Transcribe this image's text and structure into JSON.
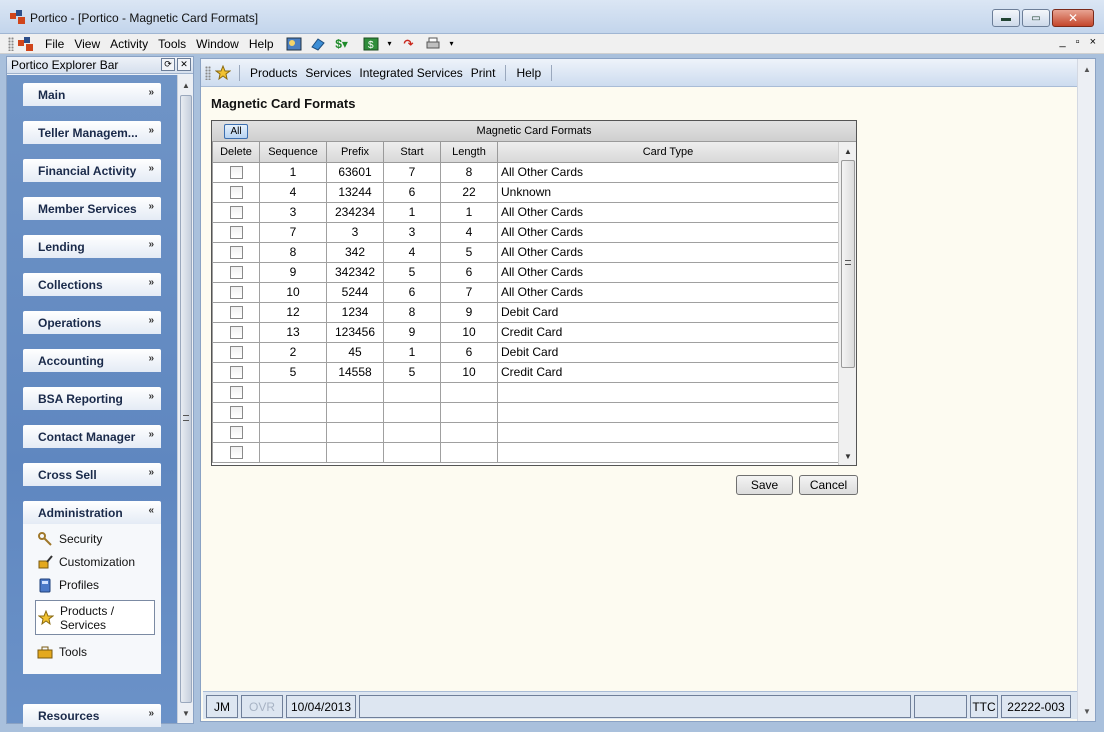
{
  "window": {
    "title": "Portico - [Portico - Magnetic Card Formats]",
    "buttons": {
      "minimize": "▬",
      "maximize": "▭",
      "close": "✕"
    }
  },
  "menubar": {
    "items": [
      "File",
      "View",
      "Activity",
      "Tools",
      "Window",
      "Help"
    ],
    "mdi": {
      "minimize": "_",
      "restore": "▫",
      "close": "×"
    }
  },
  "explorer": {
    "title": "Portico Explorer Bar",
    "groups": [
      "Main",
      "Teller Managem...",
      "Financial Activity",
      "Member Services",
      "Lending",
      "Collections",
      "Operations",
      "Accounting",
      "BSA Reporting",
      "Contact Manager",
      "Cross Sell",
      "Administration",
      "Resources"
    ],
    "admin_items": {
      "security": "Security",
      "customization": "Customization",
      "profiles": "Profiles",
      "products_line1": "Products /",
      "products_line2": "Services",
      "tools": "Tools"
    }
  },
  "inner_toolbar": {
    "items": [
      "Products",
      "Services",
      "Integrated Services",
      "Print",
      "Help"
    ]
  },
  "page": {
    "title": "Magnetic Card Formats"
  },
  "grid": {
    "caption": "Magnetic Card Formats",
    "all_button": "All",
    "columns": [
      "Delete",
      "Sequence",
      "Prefix",
      "Start",
      "Length",
      "Card Type"
    ],
    "rows": [
      {
        "sequence": "1",
        "prefix": "63601",
        "start": "7",
        "length": "8",
        "card_type": "All Other Cards"
      },
      {
        "sequence": "4",
        "prefix": "13244",
        "start": "6",
        "length": "22",
        "card_type": "Unknown"
      },
      {
        "sequence": "3",
        "prefix": "234234",
        "start": "1",
        "length": "1",
        "card_type": "All Other Cards"
      },
      {
        "sequence": "7",
        "prefix": "3",
        "start": "3",
        "length": "4",
        "card_type": "All Other Cards"
      },
      {
        "sequence": "8",
        "prefix": "342",
        "start": "4",
        "length": "5",
        "card_type": "All Other Cards"
      },
      {
        "sequence": "9",
        "prefix": "342342",
        "start": "5",
        "length": "6",
        "card_type": "All Other Cards"
      },
      {
        "sequence": "10",
        "prefix": "5244",
        "start": "6",
        "length": "7",
        "card_type": "All Other Cards"
      },
      {
        "sequence": "12",
        "prefix": "1234",
        "start": "8",
        "length": "9",
        "card_type": "Debit Card"
      },
      {
        "sequence": "13",
        "prefix": "123456",
        "start": "9",
        "length": "10",
        "card_type": "Credit Card"
      },
      {
        "sequence": "2",
        "prefix": "45",
        "start": "1",
        "length": "6",
        "card_type": "Debit Card"
      },
      {
        "sequence": "5",
        "prefix": "14558",
        "start": "5",
        "length": "10",
        "card_type": "Credit Card"
      },
      {
        "sequence": "",
        "prefix": "",
        "start": "",
        "length": "",
        "card_type": ""
      },
      {
        "sequence": "",
        "prefix": "",
        "start": "",
        "length": "",
        "card_type": ""
      },
      {
        "sequence": "",
        "prefix": "",
        "start": "",
        "length": "",
        "card_type": ""
      },
      {
        "sequence": "",
        "prefix": "",
        "start": "",
        "length": "",
        "card_type": ""
      }
    ]
  },
  "actions": {
    "save": "Save",
    "cancel": "Cancel"
  },
  "statusbar": {
    "user": "JM",
    "ovr": "OVR",
    "date": "10/04/2013",
    "mode": "TTC",
    "branch": "22222-003"
  }
}
